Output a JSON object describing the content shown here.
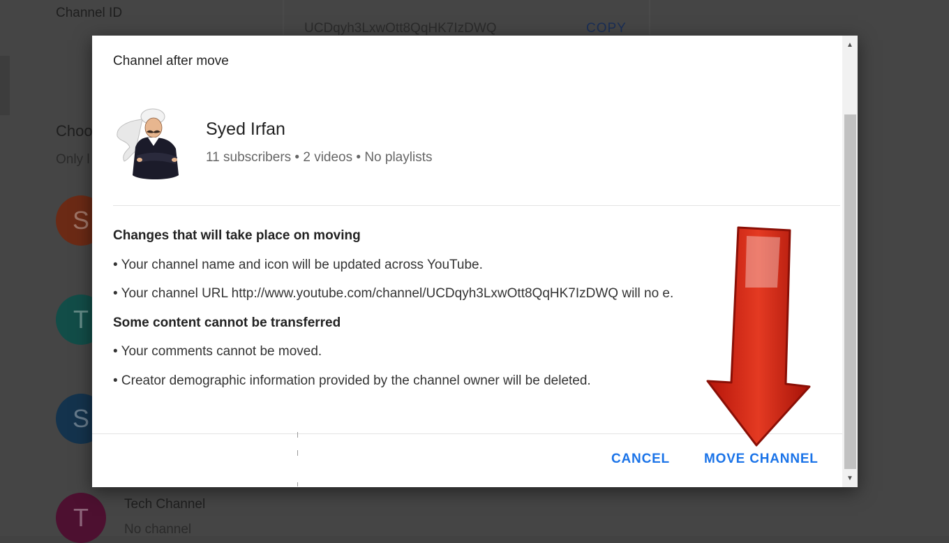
{
  "background": {
    "channel_id_label": "Channel ID",
    "channel_id_value": "UCDqyh3LxwOtt8QqHK7IzDWQ",
    "copy_label": "COPY",
    "choose_label_partial": "Choo",
    "only_label_partial": "Only l",
    "avatars": [
      {
        "letter": "S",
        "color": "#6b2a15"
      },
      {
        "letter": "T",
        "color": "#124d48"
      },
      {
        "letter": "S",
        "color": "#14334d"
      },
      {
        "letter": "T",
        "color": "#4d1030"
      }
    ],
    "tech_channel_name": "Tech Channel",
    "tech_channel_sub": "No channel"
  },
  "dialog": {
    "title": "Channel after move",
    "channel": {
      "name": "Syed Irfan",
      "stats": "11 subscribers • 2 videos • No playlists"
    },
    "changes_heading": "Changes that will take place on moving",
    "changes": [
      "• Your channel name and icon will be updated across YouTube.",
      "• Your channel URL http://www.youtube.com/channel/UCDqyh3LxwOtt8QqHK7IzDWQ will no          e."
    ],
    "nontransfer_heading": "Some content cannot be transferred",
    "nontransfer": [
      "• Your comments cannot be moved.",
      "• Creator demographic information provided by the channel owner will be deleted."
    ],
    "cancel_label": "CANCEL",
    "move_label": "MOVE CHANNEL"
  },
  "colors": {
    "accent": "#1a73e8",
    "arrow": "#d11f0f"
  }
}
